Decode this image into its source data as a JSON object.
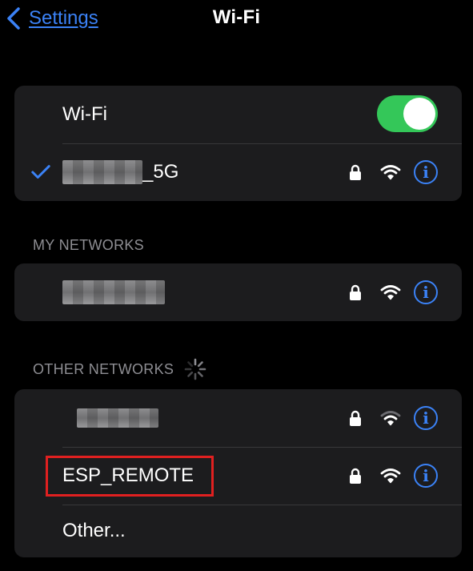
{
  "nav": {
    "back_label": "Settings",
    "title": "Wi-Fi"
  },
  "wifi_card": {
    "toggle_label": "Wi-Fi",
    "toggle_on": true,
    "connected_network_suffix": "_5G"
  },
  "sections": {
    "my_networks": "MY NETWORKS",
    "other_networks": "OTHER NETWORKS"
  },
  "other_networks": {
    "esp_name": "ESP_REMOTE",
    "other_label": "Other..."
  },
  "colors": {
    "accent": "#3b82f6",
    "toggle_on": "#34c759",
    "card_bg": "#1c1c1e",
    "highlight": "#e02020"
  },
  "icons": {
    "back": "chevron-left-icon",
    "check": "checkmark-icon",
    "lock": "lock-icon",
    "wifi": "wifi-signal-icon",
    "info": "info-icon",
    "spinner": "loading-spinner-icon"
  }
}
